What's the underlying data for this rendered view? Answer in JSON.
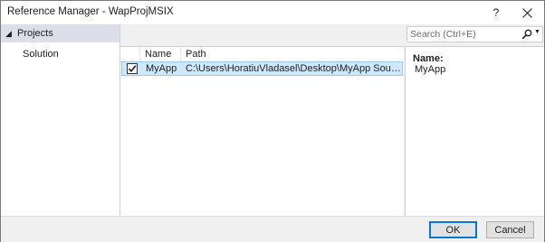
{
  "window": {
    "title": "Reference Manager - WapProjMSIX",
    "help_label": "?",
    "close_label": "close"
  },
  "nav": {
    "header_label": "Projects",
    "items": [
      {
        "label": "Solution"
      }
    ]
  },
  "search": {
    "placeholder": "Search (Ctrl+E)",
    "value": ""
  },
  "table": {
    "columns": [
      "Name",
      "Path"
    ],
    "rows": [
      {
        "checked": true,
        "name": "MyApp",
        "path": "C:\\Users\\HoratiuVladasel\\Desktop\\MyApp Source Code..."
      }
    ]
  },
  "details": {
    "name_label": "Name:",
    "name_value": "MyApp"
  },
  "footer": {
    "ok_label": "OK",
    "cancel_label": "Cancel"
  },
  "colors": {
    "selection": "#cde8ff",
    "selection_border": "#99c9ef",
    "nav_header": "#dcdfea",
    "accent": "#0078d7"
  }
}
